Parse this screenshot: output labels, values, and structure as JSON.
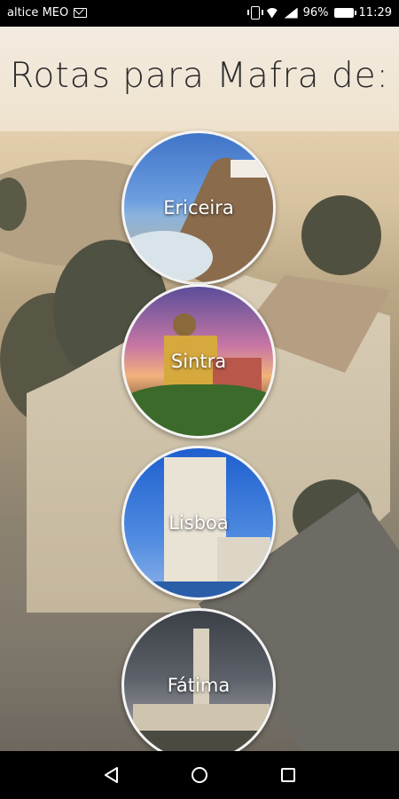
{
  "status_bar": {
    "carrier": "altice MEO",
    "battery_percent": "96%",
    "time": "11:29",
    "icons": [
      "mail-icon",
      "vibrate-icon",
      "wifi-icon",
      "signal-icon",
      "battery-icon"
    ]
  },
  "header": {
    "title": "Rotas para Mafra de:"
  },
  "routes": [
    {
      "label": "Ericeira",
      "image": "coastal-cliff-photo"
    },
    {
      "label": "Sintra",
      "image": "pena-palace-photo"
    },
    {
      "label": "Lisboa",
      "image": "belem-tower-photo"
    },
    {
      "label": "Fátima",
      "image": "fatima-sanctuary-photo"
    }
  ],
  "nav_bar": {
    "icons": [
      "back-icon",
      "home-icon",
      "recent-apps-icon"
    ]
  },
  "colors": {
    "header_background": "#efe3cf",
    "title_color": "#2a2a2a",
    "circle_border": "#f4f4f4",
    "status_bar": "#000000"
  }
}
